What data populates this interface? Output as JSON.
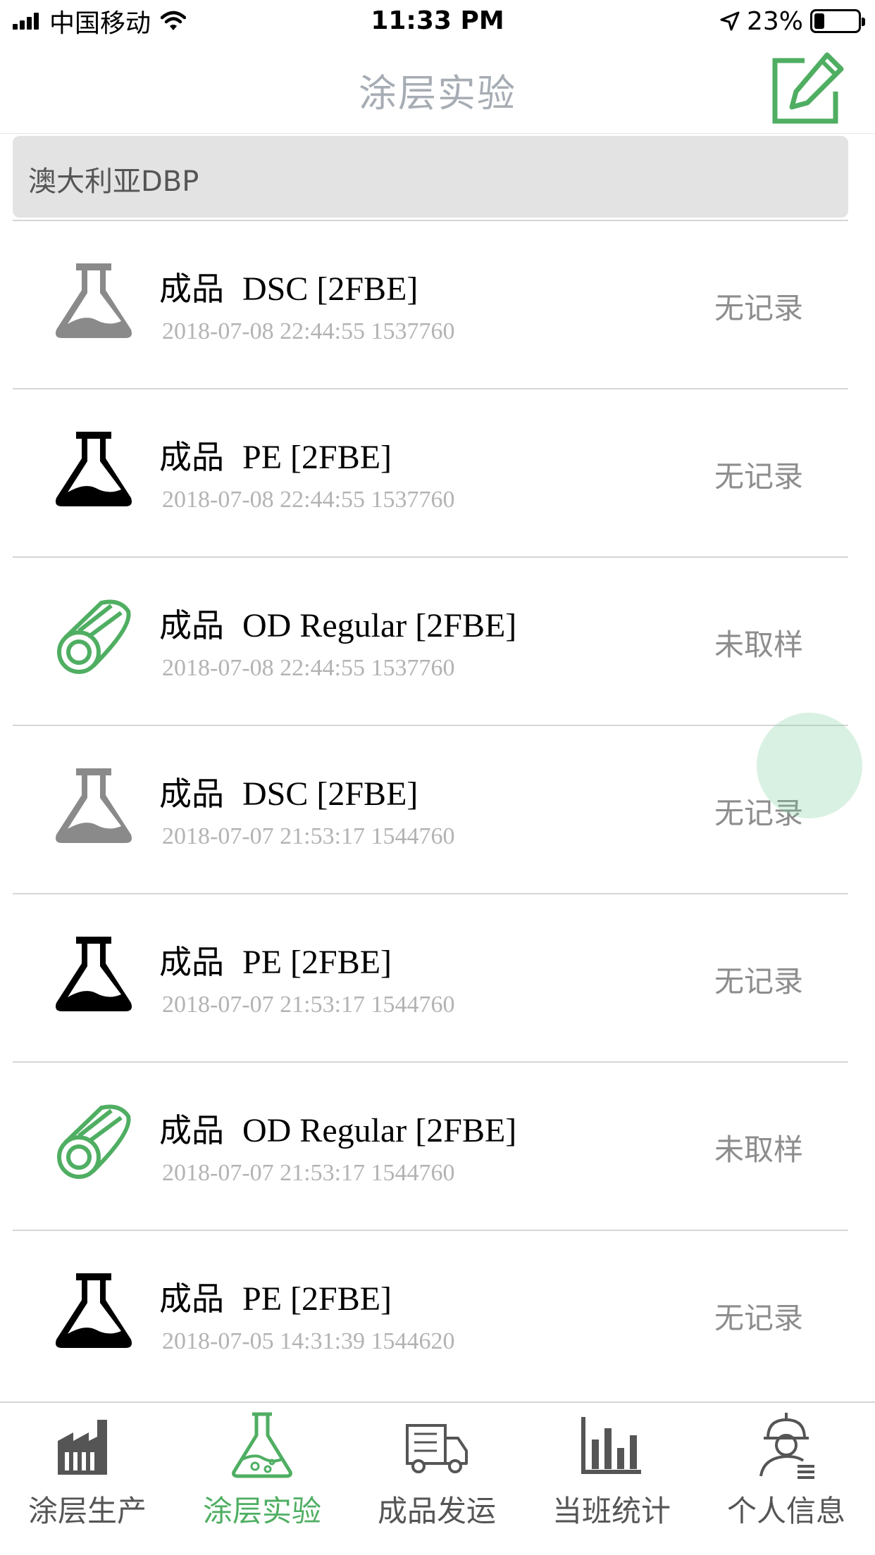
{
  "status_bar": {
    "carrier": "中国移动",
    "time": "11:33 PM",
    "battery": "23%",
    "battery_level": 0.23
  },
  "nav": {
    "title": "涂层实验",
    "edit_icon": "edit-square-icon"
  },
  "filter": {
    "text": "澳大利亚DBP"
  },
  "colors": {
    "accent": "#4fae62",
    "flask_gray": "#8a8a8a",
    "flask_black": "#000000"
  },
  "items": [
    {
      "prefix": "成品",
      "name": "DSC [2FBE]",
      "sub": "2018-07-08 22:44:55 1537760",
      "status": "无记录",
      "icon": "flask-gray-icon"
    },
    {
      "prefix": "成品",
      "name": "PE [2FBE]",
      "sub": "2018-07-08 22:44:55 1537760",
      "status": "无记录",
      "icon": "flask-black-icon"
    },
    {
      "prefix": "成品",
      "name": "OD Regular [2FBE]",
      "sub": "2018-07-08 22:44:55 1537760",
      "status": "未取样",
      "icon": "pipe-icon"
    },
    {
      "prefix": "成品",
      "name": "DSC [2FBE]",
      "sub": "2018-07-07 21:53:17 1544760",
      "status": "无记录",
      "icon": "flask-gray-icon"
    },
    {
      "prefix": "成品",
      "name": "PE [2FBE]",
      "sub": "2018-07-07 21:53:17 1544760",
      "status": "无记录",
      "icon": "flask-black-icon"
    },
    {
      "prefix": "成品",
      "name": "OD Regular [2FBE]",
      "sub": "2018-07-07 21:53:17 1544760",
      "status": "未取样",
      "icon": "pipe-icon"
    },
    {
      "prefix": "成品",
      "name": "PE [2FBE]",
      "sub": "2018-07-05 14:31:39 1544620",
      "status": "无记录",
      "icon": "flask-black-icon"
    }
  ],
  "tabs": [
    {
      "label": "涂层生产",
      "icon": "factory-icon",
      "active": false
    },
    {
      "label": "涂层实验",
      "icon": "flask-icon",
      "active": true
    },
    {
      "label": "成品发运",
      "icon": "truck-icon",
      "active": false
    },
    {
      "label": "当班统计",
      "icon": "bar-chart-icon",
      "active": false
    },
    {
      "label": "个人信息",
      "icon": "worker-icon",
      "active": false
    }
  ]
}
